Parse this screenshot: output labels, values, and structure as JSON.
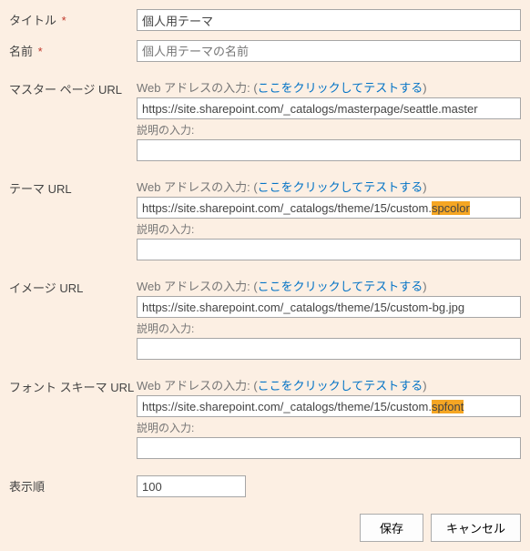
{
  "fields": {
    "title": {
      "label": "タイトル",
      "required": "*",
      "value": "個人用テーマ"
    },
    "name": {
      "label": "名前",
      "required": "*",
      "placeholder": "個人用テーマの名前",
      "value": ""
    },
    "master": {
      "label": "マスター ページ URL",
      "preText": "Web アドレスの入力: (",
      "link": "ここをクリックしてテストする",
      "postText": ")",
      "value": "https://site.sharepoint.com/_catalogs/masterpage/seattle.master",
      "descLabel": "説明の入力:",
      "descValue": ""
    },
    "theme": {
      "label": "テーマ URL",
      "preText": "Web アドレスの入力: (",
      "link": "ここをクリックしてテストする",
      "postText": ")",
      "urlBase": "https://site.sharepoint.com/_catalogs/theme/15/custom.",
      "urlHighlight": "spcolor",
      "descLabel": "説明の入力:",
      "descValue": ""
    },
    "image": {
      "label": "イメージ URL",
      "preText": "Web アドレスの入力: (",
      "link": "ここをクリックしてテストする",
      "postText": ")",
      "value": "https://site.sharepoint.com/_catalogs/theme/15/custom-bg.jpg",
      "descLabel": "説明の入力:",
      "descValue": ""
    },
    "font": {
      "label": "フォント スキーマ URL",
      "preText": "Web アドレスの入力: (",
      "link": "ここをクリックしてテストする",
      "postText": ")",
      "urlBase": "https://site.sharepoint.com/_catalogs/theme/15/custom.",
      "urlHighlight": "spfont",
      "descLabel": "説明の入力:",
      "descValue": ""
    },
    "order": {
      "label": "表示順",
      "value": "100"
    }
  },
  "buttons": {
    "save": "保存",
    "cancel": "キャンセル"
  }
}
